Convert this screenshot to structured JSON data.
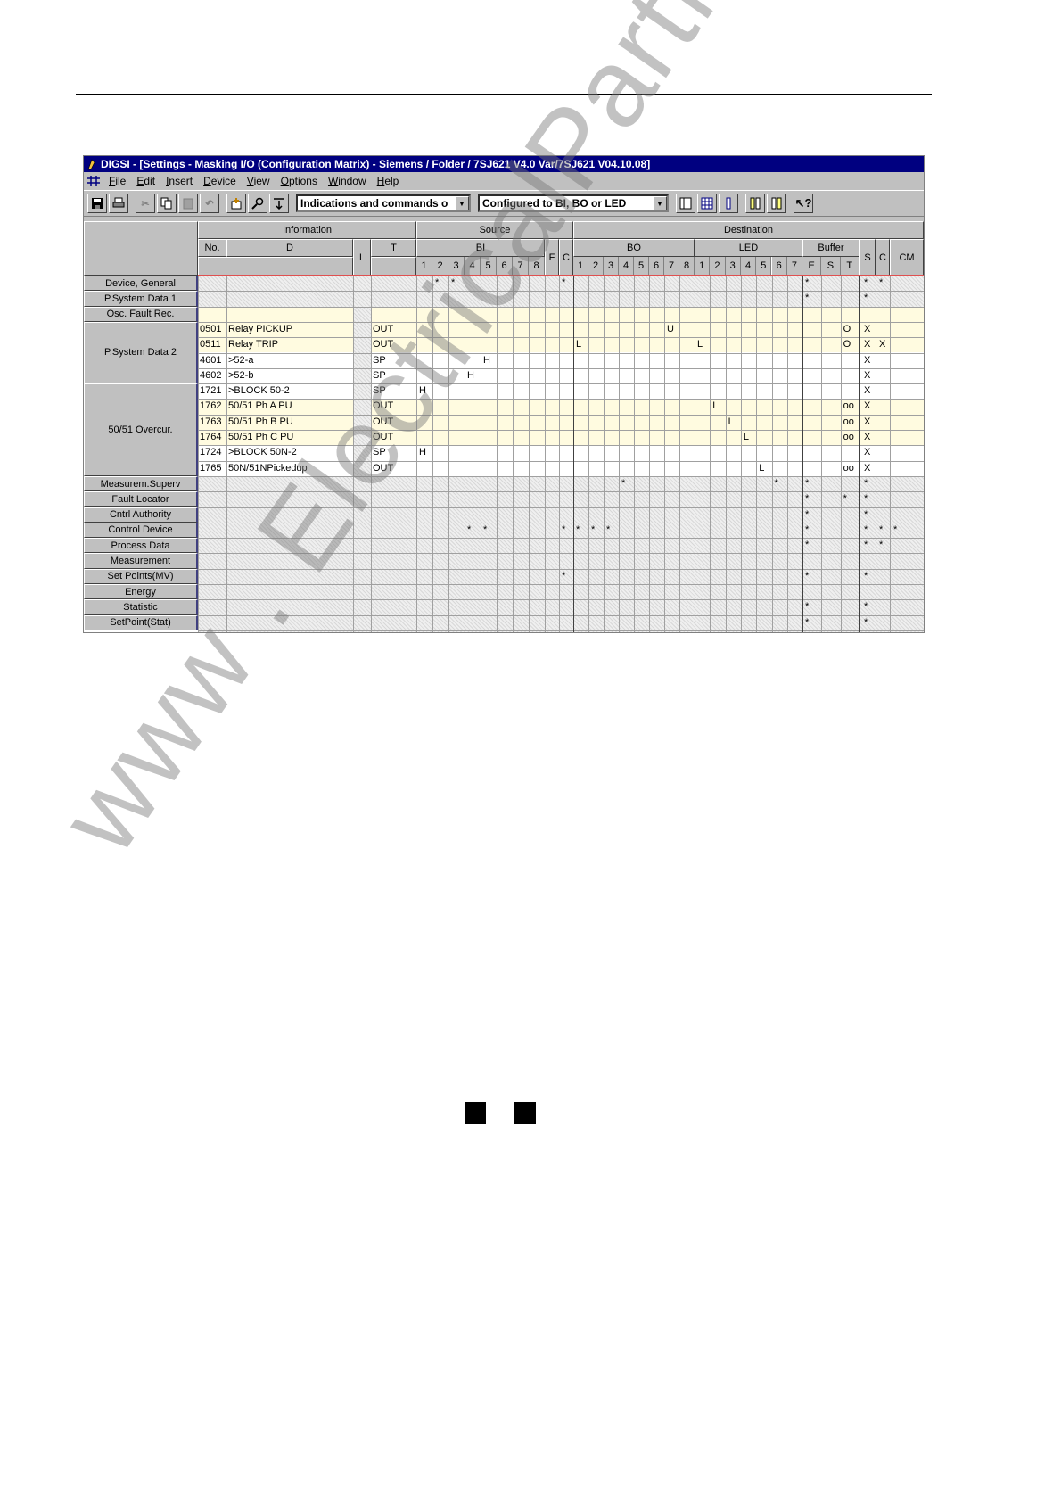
{
  "window": {
    "title": "DIGSI - [Settings - Masking I/O (Configuration Matrix) - Siemens / Folder / 7SJ621 V4.0 Var/7SJ621 V04.10.08]"
  },
  "menu": [
    "File",
    "Edit",
    "Insert",
    "Device",
    "View",
    "Options",
    "Window",
    "Help"
  ],
  "toolbar": {
    "combo_indications": "Indications and commands o",
    "combo_configured": "Configured to BI, BO or LED"
  },
  "matrix": {
    "headers": {
      "information": "Information",
      "source": "Source",
      "destination": "Destination",
      "no": "No.",
      "d": "D",
      "l": "L",
      "t": "T",
      "bi": "BI",
      "f": "F",
      "c": "C",
      "bo": "BO",
      "led": "LED",
      "buffer": "Buffer",
      "s": "S",
      "c2": "C",
      "cm": "CM",
      "bi_nums": [
        "1",
        "2",
        "3",
        "4",
        "5",
        "6",
        "7",
        "8"
      ],
      "bo_nums": [
        "1",
        "2",
        "3",
        "4",
        "5",
        "6",
        "7",
        "8"
      ],
      "led_nums": [
        "1",
        "2",
        "3",
        "4",
        "5",
        "6",
        "7"
      ],
      "buffer_sub": [
        "E",
        "S",
        "T"
      ]
    },
    "groups": [
      "Device, General",
      "P.System Data 1",
      "Osc. Fault Rec.",
      "P.System Data 2",
      "50/51 Overcur.",
      "Measurem.Superv",
      "Fault Locator",
      "Cntrl Authority",
      "Control Device",
      "Process Data",
      "Measurement",
      "Set Points(MV)",
      "Energy",
      "Statistic",
      "SetPoint(Stat)"
    ],
    "rows": [
      {
        "no": "0501",
        "d": "Relay PICKUP",
        "t": "OUT"
      },
      {
        "no": "0511",
        "d": "Relay TRIP",
        "t": "OUT"
      },
      {
        "no": "4601",
        "d": ">52-a",
        "t": "SP"
      },
      {
        "no": "4602",
        "d": ">52-b",
        "t": "SP"
      },
      {
        "no": "1721",
        "d": ">BLOCK 50-2",
        "t": "SP"
      },
      {
        "no": "1762",
        "d": "50/51 Ph A PU",
        "t": "OUT"
      },
      {
        "no": "1763",
        "d": "50/51 Ph B PU",
        "t": "OUT"
      },
      {
        "no": "1764",
        "d": "50/51 Ph C PU",
        "t": "OUT"
      },
      {
        "no": "1724",
        "d": ">BLOCK 50N-2",
        "t": "SP"
      },
      {
        "no": "1765",
        "d": "50N/51NPickedup",
        "t": "OUT"
      }
    ],
    "marks": [
      "*",
      "H",
      "U",
      "L",
      "O",
      "oo",
      "X"
    ]
  },
  "watermark": "www . ElectricalPartManuals . com"
}
